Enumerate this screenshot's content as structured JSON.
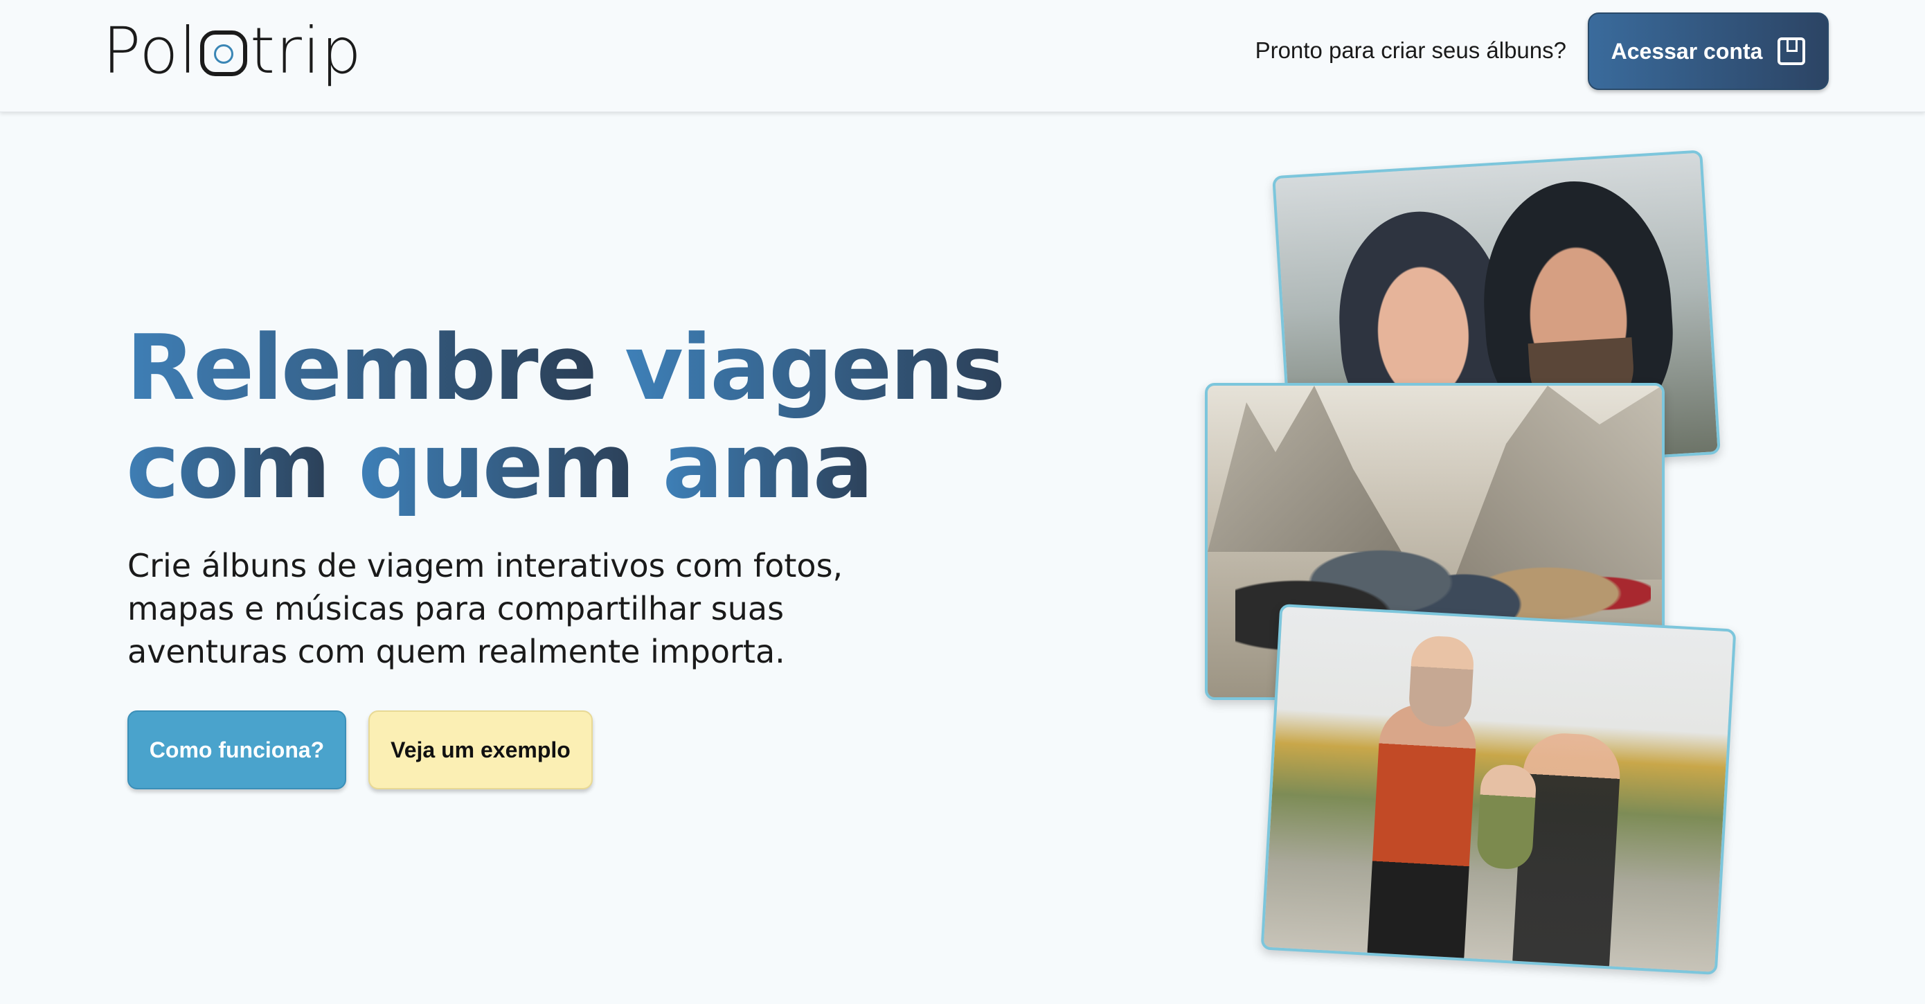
{
  "header": {
    "logo_text": "Polotrip",
    "prompt": "Pronto para criar seus álbuns?",
    "login_button": "Acessar conta",
    "login_icon": "bookmark-box-icon"
  },
  "hero": {
    "headline_line1_a": "Relembre",
    "headline_line1_b": "viagens",
    "headline_line2_a": "com",
    "headline_line2_b": "quem",
    "headline_line2_c": "ama",
    "description": "Crie álbuns de viagem interativos com fotos, mapas e músicas para compartilhar suas aventuras com quem realmente importa.",
    "how_button": "Como funciona?",
    "example_button": "Veja um exemplo"
  },
  "colors": {
    "brand_dark": "#2c4464",
    "brand_blue": "#3f7fb6",
    "accent_teal": "#4aa3cc",
    "accent_yellow": "#fbefb4",
    "photo_border": "#7cc6dc"
  }
}
